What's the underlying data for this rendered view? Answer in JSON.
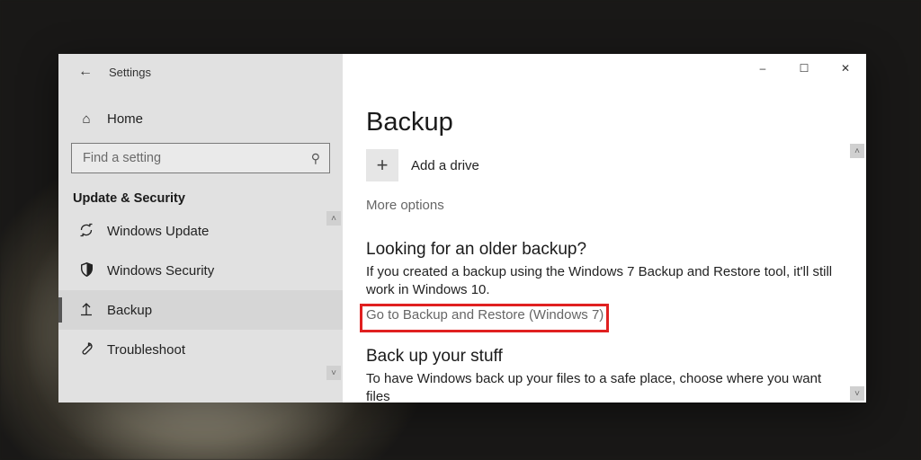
{
  "window": {
    "app_name": "Settings",
    "minimize": "–",
    "maximize": "☐",
    "close": "✕"
  },
  "sidebar": {
    "home_label": "Home",
    "search_placeholder": "Find a setting",
    "category": "Update & Security",
    "items": [
      {
        "icon": "↻",
        "label": "Windows Update"
      },
      {
        "icon": "shield",
        "label": "Windows Security"
      },
      {
        "icon": "↑",
        "label": "Backup",
        "selected": true
      },
      {
        "icon": "wrench",
        "label": "Troubleshoot"
      }
    ]
  },
  "main": {
    "title": "Backup",
    "add_drive": "Add a drive",
    "more_options": "More options",
    "older_title": "Looking for an older backup?",
    "older_body": "If you created a backup using the Windows 7 Backup and Restore tool, it'll still work in Windows 10.",
    "older_link": "Go to Backup and Restore (Windows 7)",
    "stuff_title": "Back up your stuff",
    "stuff_body": "To have Windows back up your files to a safe place, choose where you want files"
  }
}
